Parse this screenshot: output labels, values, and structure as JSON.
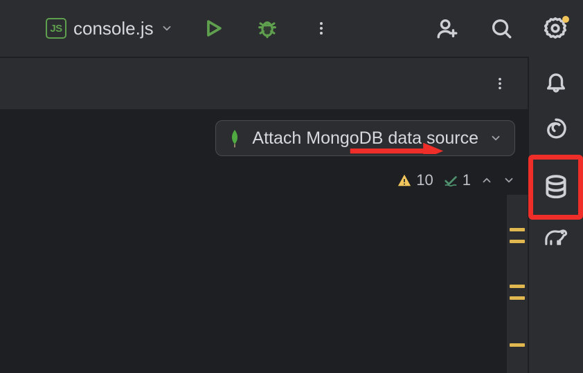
{
  "toolbar": {
    "file_name": "console.js",
    "js_icon_text": "JS"
  },
  "editor": {
    "attach_label": "Attach MongoDB data source",
    "warnings_count": "10",
    "weak_warnings_count": "1"
  }
}
